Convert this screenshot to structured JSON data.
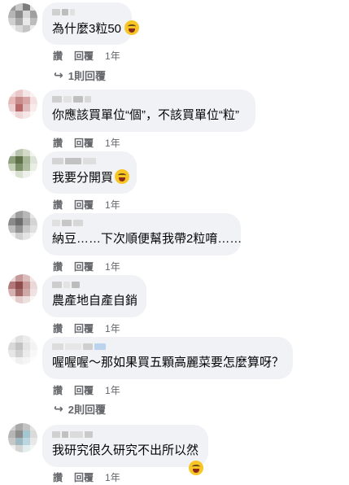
{
  "comments": [
    {
      "text": "為什麼3粒50",
      "emoji": "grinning-squint-emoji",
      "like": "讚",
      "reply": "回覆",
      "time": "1年",
      "replies": "1則回覆"
    },
    {
      "text": "你應該買單位“個”，不該買單位“粒”",
      "like": "讚",
      "reply": "回覆",
      "time": "1年"
    },
    {
      "text": "我要分開買",
      "emoji": "rolling-laugh-emoji",
      "like": "讚",
      "reply": "回覆",
      "time": "1年"
    },
    {
      "text": "納豆……下次順便幫我帶2粒唷……",
      "like": "讚",
      "reply": "回覆",
      "time": "1年"
    },
    {
      "text": "農產地自產自銷",
      "like": "讚",
      "reply": "回覆",
      "time": "1年"
    },
    {
      "text": "喔喔喔～那如果買五顆高麗菜要怎麼算呀？",
      "like": "讚",
      "reply": "回覆",
      "time": "1年",
      "replies": "2則回覆"
    },
    {
      "text": "我研究很久研究不出所以然",
      "emoji": "grinning-squint-emoji",
      "like": "讚",
      "reply": "回覆",
      "time": "1年"
    }
  ],
  "colors": {
    "bubble": "#f0f2f5",
    "meta": "#65676b",
    "text": "#050505"
  }
}
